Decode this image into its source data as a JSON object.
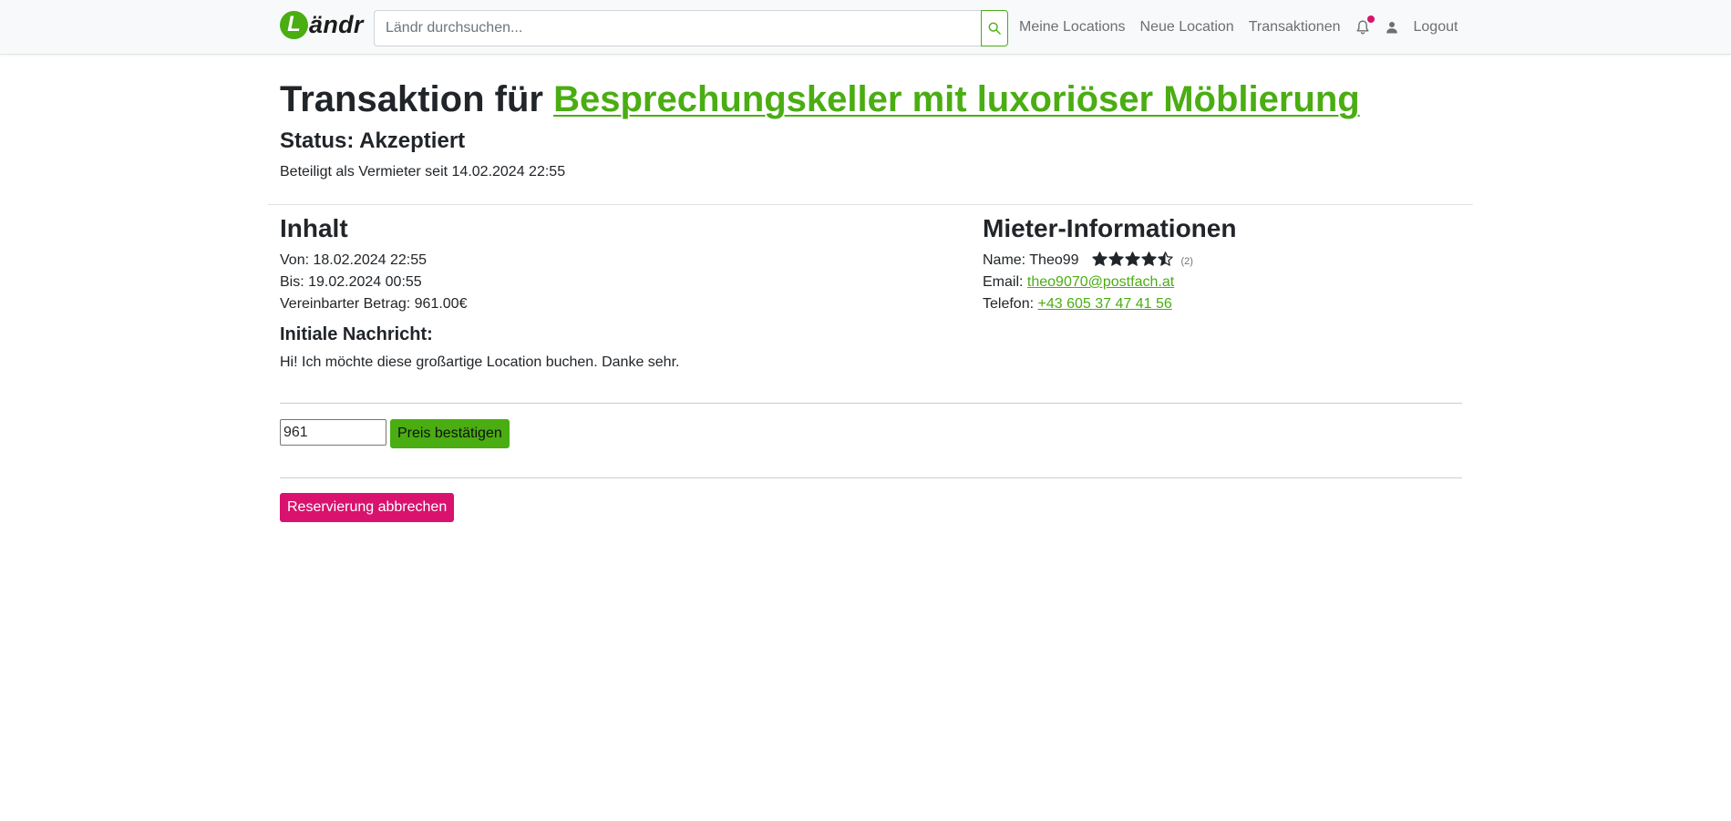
{
  "brand": {
    "logo_letter": "L",
    "name": "ändr"
  },
  "search": {
    "placeholder": "Ländr durchsuchen...",
    "value": ""
  },
  "nav": {
    "my_locations": "Meine Locations",
    "new_location": "Neue Location",
    "transactions": "Transaktionen",
    "logout": "Logout"
  },
  "transaction": {
    "title_prefix": "Transaktion für",
    "location_name": "Besprechungskeller mit luxoriöser Möblierung",
    "status": "Status: Akzeptiert",
    "involved": "Beteiligt als Vermieter seit 14.02.2024 22:55"
  },
  "content": {
    "heading": "Inhalt",
    "from": "Von: 18.02.2024 22:55",
    "until": "Bis: 19.02.2024 00:55",
    "amount": "Vereinbarter Betrag: 961.00€",
    "message_heading": "Initiale Nachricht:",
    "message": "Hi! Ich möchte diese großartige Location buchen. Danke sehr."
  },
  "tenant": {
    "heading": "Mieter-Informationen",
    "name_label": "Name: Theo99",
    "rating": 4.5,
    "rating_max": 5,
    "rating_count": "(2)",
    "email_label": "Email:",
    "email": "theo9070@postfach.at",
    "phone_label": "Telefon:",
    "phone": "+43 605 37 47 41 56"
  },
  "price_form": {
    "value": "961",
    "confirm_label": "Preis bestätigen"
  },
  "actions": {
    "cancel_label": "Reservierung abbrechen"
  },
  "colors": {
    "accent": "#4aad12",
    "danger": "#d8126e",
    "text": "#212529",
    "nav_text": "#6c6f73"
  }
}
